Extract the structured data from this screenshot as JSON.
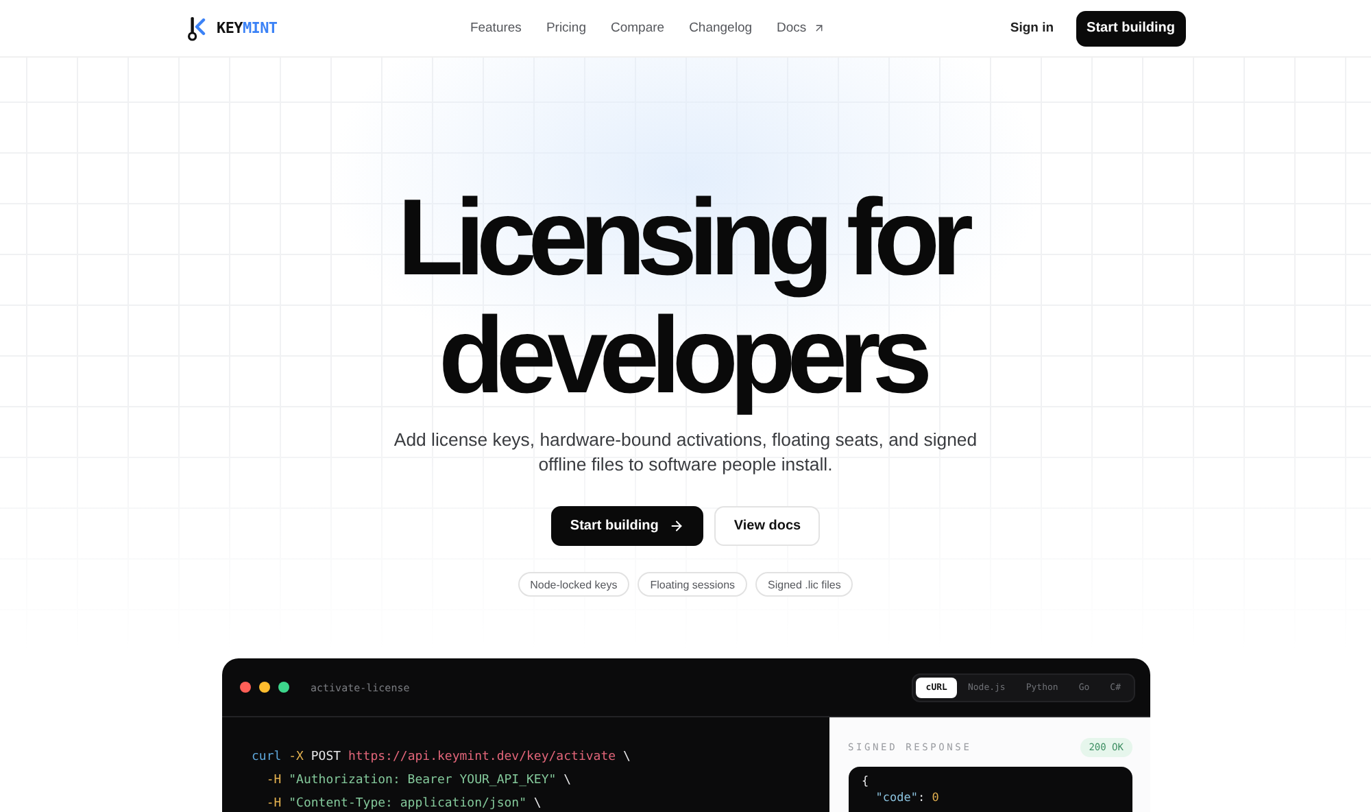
{
  "header": {
    "logo": {
      "primary": "KEY",
      "accent": "MINT"
    },
    "nav": [
      {
        "label": "Features",
        "external": false
      },
      {
        "label": "Pricing",
        "external": false
      },
      {
        "label": "Compare",
        "external": false
      },
      {
        "label": "Changelog",
        "external": false
      },
      {
        "label": "Docs",
        "external": true
      }
    ],
    "sign_in": "Sign in",
    "cta": "Start building"
  },
  "hero": {
    "title_lines": [
      "Licensing for",
      "developers"
    ],
    "subtitle_lines": [
      "Add license keys, hardware-bound activations, floating seats, and signed",
      "offline files to software people install."
    ],
    "buttons": [
      {
        "label": "Start building",
        "kind": "primary"
      },
      {
        "label": "View docs",
        "kind": "secondary"
      }
    ],
    "tags": [
      "Node-locked keys",
      "Floating sessions",
      "Signed .lic files"
    ]
  },
  "code_panel": {
    "filename": "activate-license",
    "tabs": [
      {
        "label": "cURL",
        "selected": true
      },
      {
        "label": "Node.js",
        "selected": false
      },
      {
        "label": "Python",
        "selected": false
      },
      {
        "label": "Go",
        "selected": false
      },
      {
        "label": "C#",
        "selected": false
      }
    ],
    "lines": [
      [
        {
          "kind": "command",
          "text": "curl"
        },
        {
          "kind": "flag",
          "text": " -X"
        },
        {
          "kind": "plain",
          "text": " POST"
        },
        {
          "kind": "url",
          "text": " https://api.keymint.dev/key/activate"
        },
        {
          "kind": "plain",
          "text": " \\"
        }
      ],
      [
        {
          "kind": "flag",
          "text": "  -H"
        },
        {
          "kind": "string",
          "text": " \"Authorization: Bearer YOUR_API_KEY\""
        },
        {
          "kind": "plain",
          "text": " \\"
        }
      ],
      [
        {
          "kind": "flag",
          "text": "  -H"
        },
        {
          "kind": "string",
          "text": " \"Content-Type: application/json\""
        },
        {
          "kind": "plain",
          "text": " \\"
        }
      ]
    ],
    "response": {
      "label": "SIGNED RESPONSE",
      "status": "200 OK",
      "lines": [
        [
          {
            "kind": "plain",
            "text": "{"
          }
        ],
        [
          {
            "kind": "key",
            "text": "  \"code\""
          },
          {
            "kind": "plain",
            "text": ": "
          },
          {
            "kind": "number",
            "text": "0"
          }
        ]
      ]
    }
  }
}
